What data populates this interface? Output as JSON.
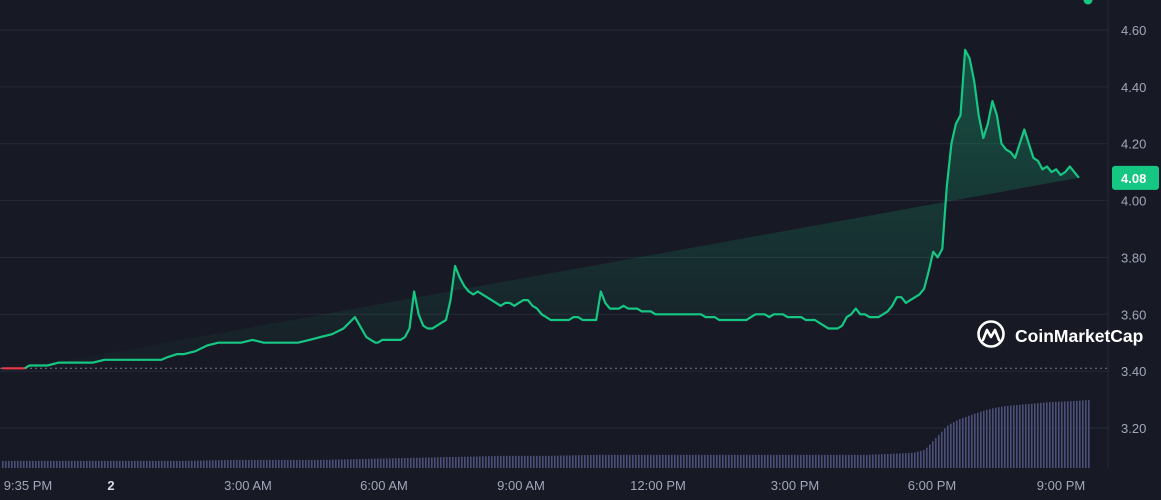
{
  "chart_data": {
    "type": "area",
    "x_ticks": [
      "9:35 PM",
      "2",
      "3:00 AM",
      "6:00 AM",
      "9:00 AM",
      "12:00 PM",
      "3:00 PM",
      "6:00 PM",
      "9:00 PM"
    ],
    "y_ticks": [
      "4.60",
      "4.40",
      "4.20",
      "4.00",
      "3.80",
      "3.60",
      "3.40",
      "3.20"
    ],
    "ylim": [
      3.08,
      4.65
    ],
    "reference_value": 3.41,
    "current_value_label": "4.08",
    "current_value": 4.08,
    "grid": true,
    "series": [
      {
        "hours_since_start": [
          0,
          0.5,
          1,
          1.2,
          1.5,
          2,
          2.5,
          3,
          3.5,
          4,
          4.5,
          5,
          5.5,
          6,
          6.5,
          7,
          7.3,
          7.7,
          8,
          8.5,
          9,
          9.5,
          10,
          10.5,
          11,
          11.5,
          12,
          12.5,
          13,
          13.5,
          14,
          14.5,
          15,
          15.5,
          16,
          16.2,
          16.4,
          16.5,
          16.7,
          16.9,
          17.1,
          17.3,
          17.5,
          17.7,
          17.9,
          18.1,
          18.3,
          18.5,
          18.7,
          18.9,
          19.1,
          19.3,
          19.5,
          19.7,
          19.9,
          20.1,
          20.3,
          20.5,
          20.7,
          20.9,
          21.1,
          21.3,
          21.5,
          21.7,
          21.9,
          22.1,
          22.3,
          22.5,
          22.7,
          22.9,
          23.1,
          23.3,
          23.5,
          23.7,
          23.9,
          24.1,
          24.3,
          24.5,
          24.7,
          24.9,
          25.1,
          25.3,
          25.5,
          25.7,
          25.9,
          26.1,
          26.3,
          26.5,
          26.7,
          26.9,
          27.1,
          27.3,
          27.5,
          27.7,
          27.9,
          28.1,
          28.3,
          28.5,
          28.7,
          28.9,
          29.1,
          29.3,
          29.5,
          29.7,
          29.9,
          30.1,
          30.3,
          30.5,
          30.7,
          30.9,
          31.1,
          31.3,
          31.5,
          31.7,
          31.9,
          32.1,
          32.3,
          32.5,
          32.7,
          32.9,
          33.1,
          33.3,
          33.5,
          33.7,
          33.9,
          34.1,
          34.3,
          34.5,
          34.7,
          34.9,
          35.1,
          35.3,
          35.5,
          35.7,
          35.9,
          36.1,
          36.3,
          36.5,
          36.7,
          36.9,
          37.1,
          37.3,
          37.5,
          37.7,
          37.9,
          38.1,
          38.3,
          38.5,
          38.7,
          38.9,
          39.1,
          39.3,
          39.5,
          39.7,
          39.9,
          40.1,
          40.3,
          40.5,
          40.7,
          40.9,
          41.1,
          41.3,
          41.5,
          41.7,
          41.9,
          42.1,
          42.3,
          42.5,
          42.7,
          42.9,
          43.1,
          43.3,
          43.5,
          43.7,
          43.9,
          44.1,
          44.3,
          44.5,
          44.7,
          44.9,
          45.1,
          45.3,
          45.5,
          45.7,
          45.9,
          46.1,
          46.3,
          46.5,
          46.7,
          46.9,
          47.1,
          47.3,
          47.5,
          47.7
        ],
        "values": [
          3.41,
          3.41,
          3.41,
          3.42,
          3.42,
          3.42,
          3.43,
          3.43,
          3.43,
          3.43,
          3.44,
          3.44,
          3.44,
          3.44,
          3.44,
          3.44,
          3.45,
          3.46,
          3.46,
          3.47,
          3.49,
          3.5,
          3.5,
          3.5,
          3.51,
          3.5,
          3.5,
          3.5,
          3.5,
          3.51,
          3.52,
          3.53,
          3.55,
          3.59,
          3.52,
          3.51,
          3.5,
          3.5,
          3.51,
          3.51,
          3.51,
          3.51,
          3.51,
          3.52,
          3.55,
          3.68,
          3.6,
          3.56,
          3.55,
          3.55,
          3.56,
          3.57,
          3.58,
          3.65,
          3.77,
          3.73,
          3.7,
          3.68,
          3.67,
          3.68,
          3.67,
          3.66,
          3.65,
          3.64,
          3.63,
          3.64,
          3.64,
          3.63,
          3.64,
          3.65,
          3.65,
          3.63,
          3.62,
          3.6,
          3.59,
          3.58,
          3.58,
          3.58,
          3.58,
          3.58,
          3.59,
          3.59,
          3.58,
          3.58,
          3.58,
          3.58,
          3.68,
          3.64,
          3.62,
          3.62,
          3.62,
          3.63,
          3.62,
          3.62,
          3.62,
          3.61,
          3.61,
          3.61,
          3.6,
          3.6,
          3.6,
          3.6,
          3.6,
          3.6,
          3.6,
          3.6,
          3.6,
          3.6,
          3.6,
          3.59,
          3.59,
          3.59,
          3.58,
          3.58,
          3.58,
          3.58,
          3.58,
          3.58,
          3.58,
          3.59,
          3.6,
          3.6,
          3.6,
          3.59,
          3.6,
          3.6,
          3.6,
          3.59,
          3.59,
          3.59,
          3.59,
          3.58,
          3.58,
          3.58,
          3.57,
          3.56,
          3.55,
          3.55,
          3.55,
          3.56,
          3.59,
          3.6,
          3.62,
          3.6,
          3.6,
          3.59,
          3.59,
          3.59,
          3.6,
          3.61,
          3.63,
          3.66,
          3.66,
          3.64,
          3.65,
          3.66,
          3.67,
          3.69,
          3.75,
          3.82,
          3.8,
          3.83,
          4.05,
          4.2,
          4.27,
          4.3,
          4.53,
          4.5,
          4.42,
          4.3,
          4.22,
          4.27,
          4.35,
          4.3,
          4.2,
          4.18,
          4.17,
          4.15,
          4.2,
          4.25,
          4.2,
          4.15,
          4.14,
          4.11,
          4.12,
          4.1,
          4.11,
          4.09,
          4.1,
          4.12,
          4.1,
          4.08
        ]
      }
    ],
    "volume": {
      "hours_since_start": [
        0,
        2,
        4,
        6,
        8,
        10,
        12,
        14,
        16,
        18,
        20,
        22,
        24,
        26,
        28,
        30,
        32,
        34,
        36,
        38,
        39,
        40,
        40.5,
        41,
        41.5,
        42,
        42.5,
        43,
        43.5,
        44,
        45,
        46,
        47,
        47.7
      ],
      "values": [
        7,
        7,
        7,
        7,
        7,
        8,
        8,
        8,
        9,
        10,
        11,
        12,
        12,
        13,
        13,
        13,
        13,
        13,
        13,
        13,
        14,
        15,
        18,
        30,
        42,
        48,
        52,
        56,
        59,
        61,
        63,
        65,
        66,
        67
      ]
    },
    "colors": {
      "up": "#16c784",
      "down": "#ea3943",
      "volume": "#4b4f7a",
      "background": "#171924",
      "grid": "#262a37",
      "label_badge": "#16c784"
    }
  },
  "brand": {
    "name": "CoinMarketCap",
    "icon": "coinmarketcap-logo-icon"
  }
}
